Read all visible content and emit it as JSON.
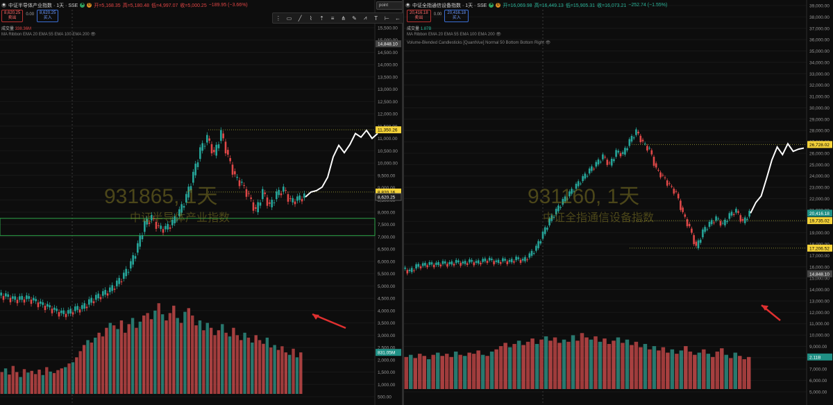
{
  "chart_data": [
    {
      "type": "candlestick",
      "symbol_code": "931865",
      "title": "中证半导体产业指数 · 1天 · SSE",
      "ohlc_header": {
        "open": "开=5,168.35",
        "high": "高=5,180.48",
        "low": "低=4,997.07",
        "close": "收=5,000.25",
        "change": "−189.95 (−3.66%)"
      },
      "quote": {
        "sell": "8,620.25",
        "sell_label": "卖出",
        "spread": "0.00",
        "buy": "8,620.25",
        "buy_label": "买入"
      },
      "volume_label": "成交量",
      "volume_value": "338.36M",
      "indicator": "MA Ribbon EMA 20 EMA 55 EMA 100 EMA 200",
      "watermark": "931865, 1天",
      "watermark_name": "中证半导体产业指数",
      "y_axis": {
        "min": 500,
        "max": 15500,
        "ticks": [
          "15,500.00",
          "15,000.00",
          "14,500.00",
          "14,000.00",
          "13,500.00",
          "13,000.00",
          "12,500.00",
          "12,000.00",
          "11,500.00",
          "11,000.00",
          "10,500.00",
          "10,000.00",
          "9,500.00",
          "9,000.00",
          "8,500.00",
          "8,000.00",
          "7,500.00",
          "7,000.00",
          "6,500.00",
          "6,000.00",
          "5,500.00",
          "5,000.00",
          "4,500.00",
          "4,000.00",
          "3,500.00",
          "3,000.00",
          "2,500.00",
          "2,000.00",
          "1,500.00",
          "1,000.00",
          "500.00"
        ]
      },
      "price_labels": [
        {
          "value": 14848.1,
          "text": "14,848.10",
          "style": "gray"
        },
        {
          "value": 11350.26,
          "text": "11,350.26",
          "style": "yellow"
        },
        {
          "value": 8820.16,
          "text": "8,820.16",
          "style": "yellow"
        },
        {
          "value": 8620.25,
          "text": "8,620.25",
          "style": "dark"
        },
        {
          "value": 2300,
          "text": "831.05M",
          "style": "teal"
        }
      ],
      "hlines": [
        11350.26,
        8820.16
      ],
      "zone": [
        7050,
        7750
      ],
      "pointer_box": "point",
      "price_path": [
        [
          0,
          4610
        ],
        [
          10,
          4560
        ],
        [
          20,
          4440
        ],
        [
          30,
          4440
        ],
        [
          40,
          4480
        ],
        [
          50,
          4380
        ],
        [
          60,
          4230
        ],
        [
          70,
          4130
        ],
        [
          80,
          3980
        ],
        [
          90,
          3860
        ],
        [
          100,
          3880
        ],
        [
          110,
          4030
        ],
        [
          120,
          4080
        ],
        [
          130,
          4320
        ],
        [
          140,
          4500
        ],
        [
          150,
          4650
        ],
        [
          160,
          4800
        ],
        [
          170,
          5080
        ],
        [
          180,
          5400
        ],
        [
          190,
          5870
        ],
        [
          200,
          6600
        ],
        [
          210,
          7500
        ],
        [
          220,
          7750
        ],
        [
          230,
          7320
        ],
        [
          240,
          7300
        ],
        [
          250,
          7550
        ],
        [
          260,
          7980
        ],
        [
          270,
          8600
        ],
        [
          280,
          9500
        ],
        [
          290,
          10500
        ],
        [
          300,
          11000
        ],
        [
          310,
          10300
        ],
        [
          320,
          11200
        ],
        [
          330,
          10200
        ],
        [
          340,
          9400
        ],
        [
          350,
          9100
        ],
        [
          360,
          8600
        ],
        [
          370,
          8000
        ],
        [
          380,
          8800
        ],
        [
          390,
          8200
        ],
        [
          400,
          8700
        ],
        [
          410,
          8900
        ],
        [
          420,
          8400
        ],
        [
          430,
          8500
        ],
        [
          440,
          8620
        ]
      ],
      "projection": [
        [
          440,
          8620
        ],
        [
          448,
          8820
        ],
        [
          456,
          8880
        ],
        [
          464,
          9020
        ],
        [
          472,
          9420
        ],
        [
          480,
          10250
        ],
        [
          488,
          10720
        ],
        [
          496,
          10420
        ],
        [
          504,
          10750
        ],
        [
          512,
          11200
        ],
        [
          520,
          11050
        ],
        [
          528,
          11330
        ],
        [
          536,
          11000
        ],
        [
          544,
          11200
        ]
      ],
      "volume": [
        1500,
        1650,
        1400,
        1750,
        1500,
        1300,
        1620,
        1480,
        1550,
        1420,
        1600,
        1380,
        1700,
        1520,
        1460,
        1580,
        1650,
        1700,
        1850,
        1900,
        2100,
        2350,
        2600,
        2800,
        2700,
        2900,
        3100,
        2950,
        3300,
        3500,
        3400,
        3250,
        3600,
        3100,
        3450,
        3700,
        3300,
        3550,
        3800,
        3900,
        3650,
        4000,
        4300,
        3850,
        3600,
        3900,
        4200,
        3700,
        3500,
        3950,
        4100,
        3800,
        3400,
        3600,
        3200,
        3500,
        3300,
        3000,
        3200,
        3450,
        3100,
        2950,
        3300,
        3000,
        2800,
        3100,
        2900,
        2700,
        3000,
        2800,
        2650,
        2900,
        2500,
        2600,
        2400,
        2550,
        2300,
        2200,
        2450,
        2100,
        2300
      ]
    },
    {
      "type": "candlestick",
      "symbol_code": "931160",
      "title": "中证全指通信设备指数 · 1天 · SSE",
      "ohlc_header": {
        "open": "开=16,069.98",
        "high": "高=16,449.13",
        "low": "低=15,905.31",
        "close": "收=16,073.21",
        "change": "−252.74 (−1.55%)"
      },
      "quote": {
        "sell": "20,416.18",
        "sell_label": "卖出",
        "spread": "0.00",
        "buy": "20,416.18",
        "buy_label": "买入"
      },
      "volume_label": "成交量",
      "volume_value": "1.87B",
      "indicator": "MA Ribbon EMA 20 EMA 55 EMA 100 EMA 200",
      "indicator2": "Volume-Blended Candlesticks [QuantVue] Normal 50 Bottom Bottom Right",
      "watermark": "931160, 1天",
      "watermark_name": "中证全指通信设备指数",
      "y_axis": {
        "min": 4000,
        "max": 39500,
        "ticks": [
          "39,000.00",
          "38,000.00",
          "37,000.00",
          "36,000.00",
          "35,000.00",
          "34,000.00",
          "33,000.00",
          "32,000.00",
          "31,000.00",
          "30,000.00",
          "29,000.00",
          "28,000.00",
          "27,000.00",
          "26,000.00",
          "25,000.00",
          "24,000.00",
          "23,000.00",
          "22,000.00",
          "21,000.00",
          "20,000.00",
          "19,000.00",
          "18,000.00",
          "17,000.00",
          "16,000.00",
          "15,000.00",
          "14,000.00",
          "13,000.00",
          "12,000.00",
          "11,000.00",
          "10,000.00",
          "9,000.00",
          "8,000.00",
          "7,000.00",
          "6,000.00",
          "5,000.00"
        ]
      },
      "price_labels": [
        {
          "value": 26728.02,
          "text": "26,728.02",
          "style": "yellow"
        },
        {
          "value": 20416.18,
          "text": "20,416.18",
          "style": "teal"
        },
        {
          "value": 19735.02,
          "text": "19,735.02",
          "style": "yellow"
        },
        {
          "value": 17206.52,
          "text": "17,206.52",
          "style": "yellow"
        },
        {
          "value": 14848.1,
          "text": "14,848.10",
          "style": "gray"
        },
        {
          "value": 7200,
          "text": "2.11B",
          "style": "teal"
        }
      ],
      "hlines": [
        26728.02,
        19735.02,
        17206.52
      ],
      "price_path": [
        [
          0,
          15300
        ],
        [
          10,
          15000
        ],
        [
          20,
          15500
        ],
        [
          30,
          15600
        ],
        [
          40,
          15700
        ],
        [
          50,
          15650
        ],
        [
          60,
          15800
        ],
        [
          70,
          15700
        ],
        [
          80,
          15900
        ],
        [
          90,
          15750
        ],
        [
          100,
          15950
        ],
        [
          110,
          15800
        ],
        [
          120,
          16000
        ],
        [
          130,
          16100
        ],
        [
          140,
          15850
        ],
        [
          150,
          16050
        ],
        [
          160,
          15900
        ],
        [
          170,
          16200
        ],
        [
          180,
          16000
        ],
        [
          190,
          16500
        ],
        [
          200,
          17200
        ],
        [
          210,
          18500
        ],
        [
          220,
          19700
        ],
        [
          230,
          20600
        ],
        [
          240,
          21500
        ],
        [
          250,
          22200
        ],
        [
          260,
          22900
        ],
        [
          270,
          23600
        ],
        [
          280,
          24300
        ],
        [
          290,
          24900
        ],
        [
          300,
          25600
        ],
        [
          310,
          24800
        ],
        [
          320,
          26000
        ],
        [
          330,
          25800
        ],
        [
          340,
          27000
        ],
        [
          350,
          27900
        ],
        [
          360,
          26800
        ],
        [
          370,
          26200
        ],
        [
          380,
          24400
        ],
        [
          390,
          23700
        ],
        [
          400,
          22900
        ],
        [
          410,
          22200
        ],
        [
          420,
          20300
        ],
        [
          430,
          19000
        ],
        [
          440,
          17200
        ],
        [
          450,
          18700
        ],
        [
          460,
          19400
        ],
        [
          470,
          19900
        ],
        [
          480,
          19300
        ],
        [
          490,
          20200
        ],
        [
          500,
          20600
        ],
        [
          510,
          19500
        ],
        [
          520,
          20416
        ]
      ],
      "projection": [
        [
          520,
          20416
        ],
        [
          528,
          21400
        ],
        [
          536,
          22000
        ],
        [
          544,
          23600
        ],
        [
          552,
          25300
        ],
        [
          560,
          26500
        ],
        [
          568,
          25800
        ],
        [
          576,
          26800
        ],
        [
          584,
          26100
        ],
        [
          592,
          26300
        ],
        [
          600,
          26400
        ]
      ],
      "volume": [
        7200,
        7400,
        7100,
        7500,
        7300,
        7000,
        7400,
        7600,
        7300,
        7500,
        7200,
        7700,
        7400,
        7300,
        7600,
        7500,
        7800,
        7400,
        7300,
        7700,
        7900,
        8200,
        8500,
        8100,
        8400,
        8700,
        8300,
        8600,
        8900,
        8400,
        8800,
        9100,
        8700,
        9000,
        8500,
        8800,
        8600,
        9200,
        8700,
        9400,
        9000,
        8800,
        9100,
        8600,
        8900,
        8400,
        8700,
        9000,
        8500,
        8800,
        8300,
        8600,
        8100,
        8400,
        7900,
        8200,
        7800,
        8100,
        7600,
        7900,
        7500,
        7800,
        8200,
        7700,
        7400,
        7600,
        7900,
        7500,
        7200,
        7700,
        8000,
        7400,
        7100,
        7600,
        7300,
        7000,
        7200
      ]
    }
  ]
}
